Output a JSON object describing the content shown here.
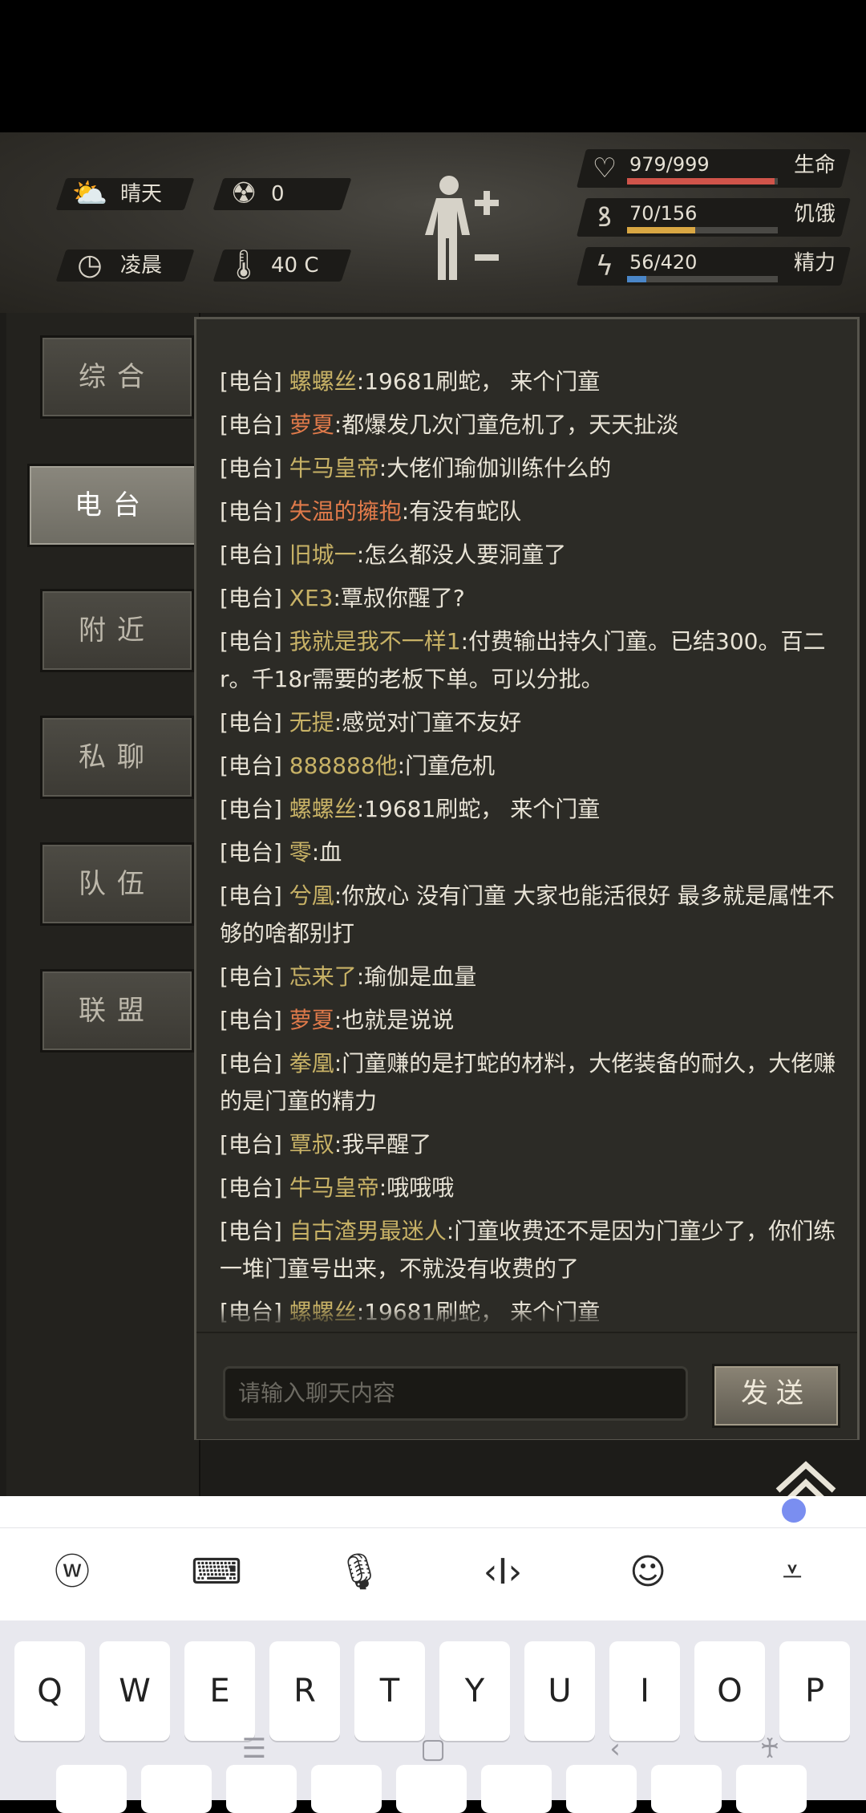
{
  "status": {
    "weather": {
      "icon": "cloud-sun-icon",
      "label": "晴天"
    },
    "radiation": {
      "icon": "radiation-icon",
      "value": "0"
    },
    "time": {
      "icon": "clock-icon",
      "label": "凌晨"
    },
    "temperature": {
      "icon": "thermometer-icon",
      "value": "40 C"
    },
    "body_icon": "body-figure-icon",
    "stats": [
      {
        "icon": "heart-icon",
        "value": "979/999",
        "name": "生命",
        "fraction": 0.98,
        "color": "#d0544a"
      },
      {
        "icon": "stomach-icon",
        "value": "70/156",
        "name": "饥饿",
        "fraction": 0.45,
        "color": "#d9a743"
      },
      {
        "icon": "energy-icon",
        "value": "56/420",
        "name": "精力",
        "fraction": 0.13,
        "color": "#4a86c8"
      }
    ]
  },
  "sidebar": {
    "tabs": [
      {
        "label": "综合",
        "active": false
      },
      {
        "label": "电台",
        "active": true
      },
      {
        "label": "附近",
        "active": false
      },
      {
        "label": "私聊",
        "active": false
      },
      {
        "label": "队伍",
        "active": false
      },
      {
        "label": "联盟",
        "active": false
      }
    ]
  },
  "chat": {
    "channel": "[电台]",
    "messages": [
      {
        "user": "螺螺丝",
        "text": ":19681刷蛇， 来个门童",
        "red": false
      },
      {
        "user": "萝夏",
        "text": ":都爆发几次门童危机了，天天扯淡",
        "red": true
      },
      {
        "user": "牛马皇帝",
        "text": ":大佬们瑜伽训练什么的",
        "red": false
      },
      {
        "user": "失温的擁抱",
        "text": ":有没有蛇队",
        "red": true
      },
      {
        "user": "旧城一",
        "text": ":怎么都没人要洞童了",
        "red": false
      },
      {
        "user": "XE3",
        "text": ":覃叔你醒了?",
        "red": false
      },
      {
        "user": "我就是我不一样1",
        "text": ":付费输出持久门童。已结300。百二r。千18r需要的老板下单。可以分批。",
        "red": false
      },
      {
        "user": "无提",
        "text": ":感觉对门童不友好",
        "red": false
      },
      {
        "user": "888888他",
        "text": ":门童危机",
        "red": false
      },
      {
        "user": "螺螺丝",
        "text": ":19681刷蛇， 来个门童",
        "red": false
      },
      {
        "user": "零",
        "text": ":血",
        "red": false
      },
      {
        "user": "兮凰",
        "text": ":你放心 没有门童 大家也能活很好 最多就是属性不够的啥都别打",
        "red": false
      },
      {
        "user": "忘来了",
        "text": ":瑜伽是血量",
        "red": false
      },
      {
        "user": "萝夏",
        "text": ":也就是说说",
        "red": true
      },
      {
        "user": "拳凰",
        "text": ":门童赚的是打蛇的材料，大佬装备的耐久，大佬赚的是门童的精力",
        "red": false
      },
      {
        "user": "覃叔",
        "text": ":我早醒了",
        "red": false
      },
      {
        "user": "牛马皇帝",
        "text": ":哦哦哦",
        "red": false
      },
      {
        "user": "自古渣男最迷人",
        "text": ":门童收费还不是因为门童少了，你们练一堆门童号出来，不就没有收费的了",
        "red": false
      },
      {
        "user": "螺螺丝",
        "text": ":19681刷蛇， 来个门童",
        "red": false
      }
    ],
    "input_placeholder": "请输入聊天内容",
    "send_label": "发送"
  },
  "keyboard": {
    "toolbar": [
      "handwriting-icon",
      "keyboard-icon",
      "microphone-icon",
      "cursor-icon",
      "emoji-icon",
      "collapse-icon"
    ],
    "row1": [
      "Q",
      "W",
      "E",
      "R",
      "T",
      "Y",
      "U",
      "I",
      "O",
      "P"
    ],
    "nav": [
      "menu-icon",
      "home-icon",
      "back-icon",
      "accessibility-icon"
    ]
  }
}
